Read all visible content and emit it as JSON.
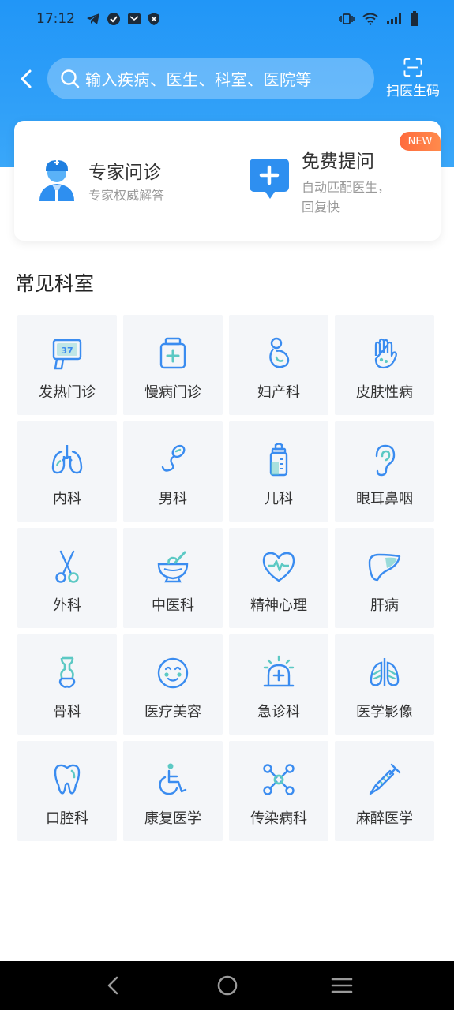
{
  "status": {
    "time": "17:12"
  },
  "search": {
    "placeholder": "输入疾病、医生、科室、医院等"
  },
  "scan": {
    "label": "扫医生码"
  },
  "services": [
    {
      "title": "专家问诊",
      "subtitle": "专家权威解答"
    },
    {
      "title": "免费提问",
      "subtitle_line1": "自动匹配医生，",
      "subtitle_line2": "回复快",
      "badge": "NEW"
    }
  ],
  "section": {
    "title": "常见科室"
  },
  "departments": [
    {
      "label": "发热门诊",
      "icon": "thermometer-icon"
    },
    {
      "label": "慢病门诊",
      "icon": "medicine-bottle-icon"
    },
    {
      "label": "妇产科",
      "icon": "pregnancy-icon"
    },
    {
      "label": "皮肤性病",
      "icon": "hand-icon"
    },
    {
      "label": "内科",
      "icon": "lungs-icon"
    },
    {
      "label": "男科",
      "icon": "sperm-icon"
    },
    {
      "label": "儿科",
      "icon": "baby-bottle-icon"
    },
    {
      "label": "眼耳鼻咽",
      "icon": "ear-icon"
    },
    {
      "label": "外科",
      "icon": "scissors-icon"
    },
    {
      "label": "中医科",
      "icon": "mortar-icon"
    },
    {
      "label": "精神心理",
      "icon": "heart-pulse-icon"
    },
    {
      "label": "肝病",
      "icon": "liver-icon"
    },
    {
      "label": "骨科",
      "icon": "bone-icon"
    },
    {
      "label": "医疗美容",
      "icon": "face-icon"
    },
    {
      "label": "急诊科",
      "icon": "emergency-light-icon"
    },
    {
      "label": "医学影像",
      "icon": "xray-lungs-icon"
    },
    {
      "label": "口腔科",
      "icon": "tooth-icon"
    },
    {
      "label": "康复医学",
      "icon": "wheelchair-icon"
    },
    {
      "label": "传染病科",
      "icon": "virus-icon"
    },
    {
      "label": "麻醉医学",
      "icon": "syringe-icon"
    }
  ],
  "colors": {
    "header": "#2196f7",
    "accent": "#3a8cf0",
    "icon_teal": "#5cc9c4",
    "tile_bg": "#f4f6f9",
    "badge": "#ff6b3d"
  }
}
